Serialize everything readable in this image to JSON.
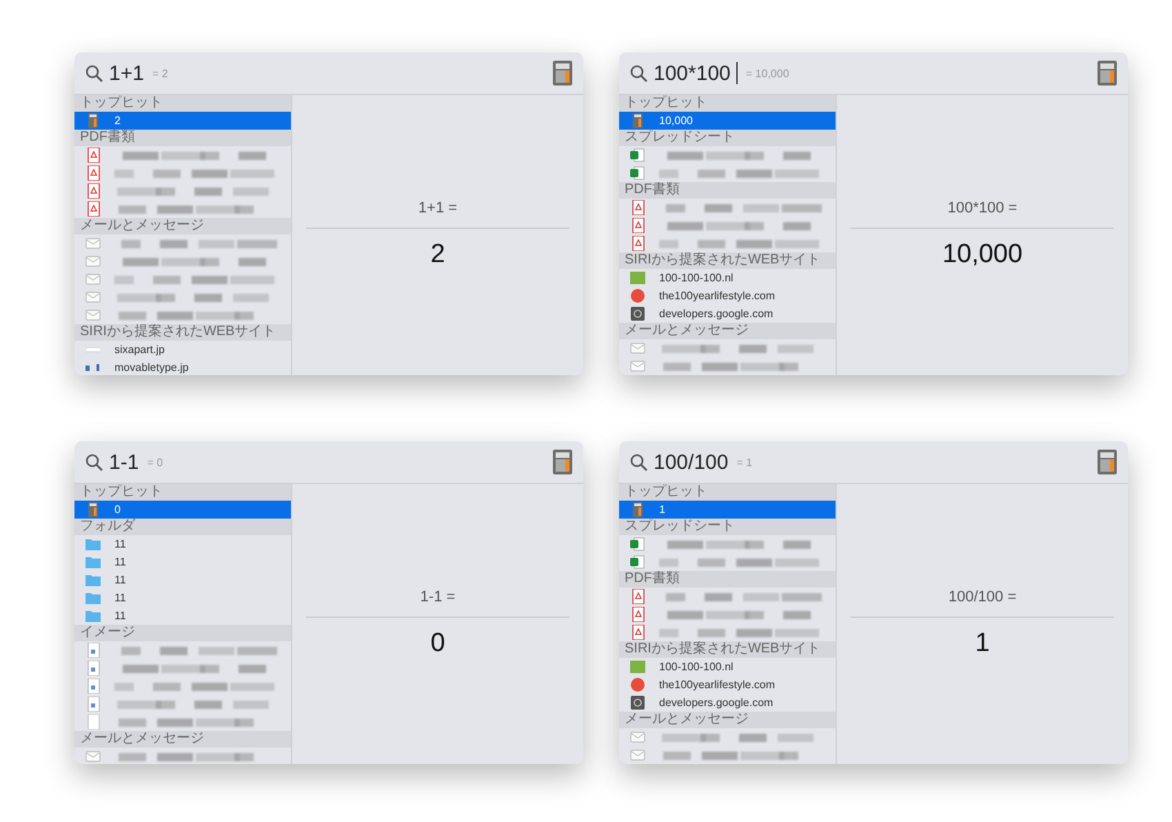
{
  "windows": [
    {
      "query": "1+1",
      "inline_result": "= 2",
      "cursor": false,
      "sections": [
        {
          "title": "トップヒット",
          "items": [
            {
              "kind": "calculator",
              "label": "2",
              "selected": true
            }
          ]
        },
        {
          "title": "PDF書類",
          "items": [
            {
              "kind": "pdf",
              "selected": false
            },
            {
              "kind": "pdf",
              "selected": false
            },
            {
              "kind": "pdf",
              "selected": false
            },
            {
              "kind": "pdf",
              "selected": false
            }
          ]
        },
        {
          "title": "メールとメッセージ",
          "items": [
            {
              "kind": "mail",
              "selected": false
            },
            {
              "kind": "mail",
              "selected": false
            },
            {
              "kind": "mail",
              "selected": false
            },
            {
              "kind": "mail",
              "selected": false
            },
            {
              "kind": "mail",
              "selected": false
            }
          ]
        },
        {
          "title": "SIRIから提案されたWEBサイト",
          "items": [
            {
              "kind": "blank-site",
              "label": "sixapart.jp",
              "selected": false
            },
            {
              "kind": "mt-site",
              "label": "movabletype.jp",
              "selected": false
            }
          ]
        }
      ],
      "preview": {
        "expression": "1+1 =",
        "result": "2"
      }
    },
    {
      "query": "100*100",
      "inline_result": "= 10,000",
      "cursor": true,
      "sections": [
        {
          "title": "トップヒット",
          "items": [
            {
              "kind": "calculator",
              "label": "10,000",
              "selected": true
            }
          ]
        },
        {
          "title": "スプレッドシート",
          "items": [
            {
              "kind": "sheet",
              "selected": false
            },
            {
              "kind": "sheet",
              "selected": false
            }
          ]
        },
        {
          "title": "PDF書類",
          "items": [
            {
              "kind": "pdf",
              "selected": false
            },
            {
              "kind": "pdf",
              "selected": false
            },
            {
              "kind": "pdf",
              "selected": false
            }
          ]
        },
        {
          "title": "SIRIから提案されたWEBサイト",
          "items": [
            {
              "kind": "green-site",
              "label": "100-100-100.nl",
              "selected": false
            },
            {
              "kind": "red-site",
              "label": "the100yearlifestyle.com",
              "selected": false
            },
            {
              "kind": "dev-site",
              "label": "developers.google.com",
              "selected": false
            }
          ]
        },
        {
          "title": "メールとメッセージ",
          "items": [
            {
              "kind": "mail",
              "selected": false
            },
            {
              "kind": "mail",
              "selected": false
            }
          ]
        }
      ],
      "preview": {
        "expression": "100*100 =",
        "result": "10,000"
      }
    },
    {
      "query": "1-1",
      "inline_result": "= 0",
      "cursor": false,
      "sections": [
        {
          "title": "トップヒット",
          "items": [
            {
              "kind": "calculator",
              "label": "0",
              "selected": true
            }
          ]
        },
        {
          "title": "フォルダ",
          "items": [
            {
              "kind": "folder",
              "label": "11",
              "selected": false
            },
            {
              "kind": "folder",
              "label": "11",
              "selected": false
            },
            {
              "kind": "folder",
              "label": "11",
              "selected": false
            },
            {
              "kind": "folder",
              "label": "11",
              "selected": false
            },
            {
              "kind": "folder",
              "label": "11",
              "selected": false
            }
          ]
        },
        {
          "title": "イメージ",
          "items": [
            {
              "kind": "image",
              "selected": false
            },
            {
              "kind": "image",
              "selected": false
            },
            {
              "kind": "image",
              "selected": false
            },
            {
              "kind": "image",
              "selected": false
            },
            {
              "kind": "doc",
              "selected": false
            }
          ]
        },
        {
          "title": "メールとメッセージ",
          "items": [
            {
              "kind": "mail",
              "selected": false
            }
          ]
        }
      ],
      "preview": {
        "expression": "1-1 =",
        "result": "0"
      }
    },
    {
      "query": "100/100",
      "inline_result": "= 1",
      "cursor": false,
      "sections": [
        {
          "title": "トップヒット",
          "items": [
            {
              "kind": "calculator",
              "label": "1",
              "selected": true
            }
          ]
        },
        {
          "title": "スプレッドシート",
          "items": [
            {
              "kind": "sheet",
              "selected": false
            },
            {
              "kind": "sheet",
              "selected": false
            }
          ]
        },
        {
          "title": "PDF書類",
          "items": [
            {
              "kind": "pdf",
              "selected": false
            },
            {
              "kind": "pdf",
              "selected": false
            },
            {
              "kind": "pdf",
              "selected": false
            }
          ]
        },
        {
          "title": "SIRIから提案されたWEBサイト",
          "items": [
            {
              "kind": "green-site",
              "label": "100-100-100.nl",
              "selected": false
            },
            {
              "kind": "red-site",
              "label": "the100yearlifestyle.com",
              "selected": false
            },
            {
              "kind": "dev-site",
              "label": "developers.google.com",
              "selected": false
            }
          ]
        },
        {
          "title": "メールとメッセージ",
          "items": [
            {
              "kind": "mail",
              "selected": false
            },
            {
              "kind": "mail",
              "selected": false
            }
          ]
        }
      ],
      "preview": {
        "expression": "100/100 =",
        "result": "1"
      }
    }
  ]
}
